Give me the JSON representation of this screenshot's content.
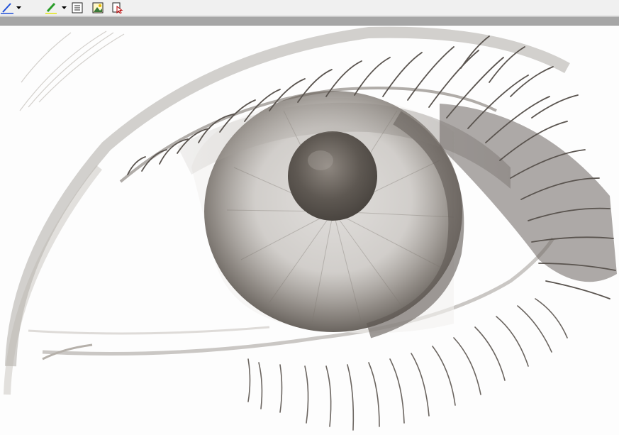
{
  "toolbar": {
    "tools": [
      {
        "icon": "pen-icon",
        "color": "#1f4fd8"
      },
      {
        "icon": "highlighter-icon",
        "color": "#2a9d2a"
      },
      {
        "icon": "text-box-icon"
      },
      {
        "icon": "insert-picture-icon"
      },
      {
        "icon": "select-tool-icon"
      }
    ]
  },
  "canvas": {
    "content": "pencil-sketch-eye",
    "ink_color": "#6b6560",
    "background": "#fdfdfd"
  }
}
